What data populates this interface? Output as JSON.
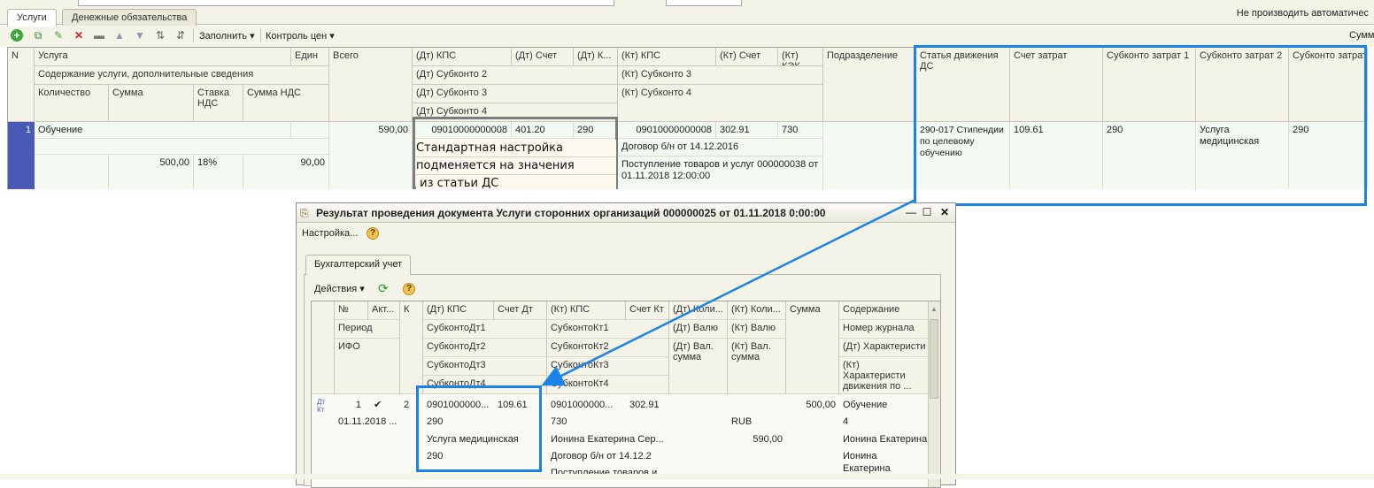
{
  "tabs": [
    "Услуги",
    "Денежные обязательства"
  ],
  "auto_label": "Не производить автоматичес",
  "toolbar": {
    "fill": "Заполнить",
    "price_control": "Контроль цен",
    "sum_label": "Сумм"
  },
  "grid": {
    "headers": {
      "n": "N",
      "service": "Услуга",
      "unit": "Един",
      "content": "Содержание услуги, дополнительные сведения",
      "qty": "Количество",
      "sum": "Сумма",
      "vat_rate": "Ставка НДС",
      "vat_sum": "Сумма НДС",
      "total": "Всего",
      "dt_kps": "(Дт) КПС",
      "dt_account": "(Дт) Счет",
      "dt_k": "(Дт) К...",
      "dt_sub2": "(Дт) Субконто 2",
      "dt_sub3": "(Дт) Субконто 3",
      "dt_sub4": "(Дт) Субконто 4",
      "kt_kps": "(Кт) КПС",
      "kt_account": "(Кт) Счет",
      "kt_kek": "(Кт) КЭК",
      "kt_sub3": "(Кт) Субконто 3",
      "kt_sub4": "(Кт) Субконто 4",
      "division": "Подразделение",
      "cashflow": "Статья движения ДС",
      "cost_account": "Счет затрат",
      "cost_sub1": "Субконто затрат 1",
      "cost_sub2": "Субконто затрат 2",
      "cost_sub3": "Субконто затрат 3"
    },
    "row": {
      "n": "1",
      "service": "Обучение",
      "sum": "500,00",
      "vat_rate": "18%",
      "vat_sum": "90,00",
      "total": "590,00",
      "dt_kps": "09010000000008",
      "dt_account": "401.20",
      "dt_k": "290",
      "kt_kps": "09010000000008",
      "kt_account": "302.91",
      "kt_kek": "730",
      "kt_sub3": "Договор б/н от 14.12.2016",
      "kt_sub4": "Поступление товаров и услуг 000000038 от 01.11.2018 12:00:00",
      "cashflow": "290-017 Стипендии по целевому обучению",
      "cost_account": "109.61",
      "cost_sub1": "290",
      "cost_sub2": "Услуга медицинская",
      "cost_sub3": "290"
    }
  },
  "callout": [
    "Стандартная настройка",
    "подменяется на значения",
    " из статьи ДС"
  ],
  "dialog": {
    "title": "Результат проведения документа Услуги сторонних организаций 000000025 от 01.11.2018 0:00:00",
    "settings": "Настройка...",
    "tab": "Бухгалтерский учет",
    "actions": "Действия",
    "headers": {
      "num": "№",
      "act": "Акт...",
      "k": "К",
      "period": "Период",
      "ifo": "ИФО",
      "dt_kps": "(Дт) КПС",
      "dt_account": "Счет Дт",
      "sub_dt1": "СубконтоДт1",
      "sub_dt2": "СубконтоДт2",
      "sub_dt3": "СубконтоДт3",
      "sub_dt4": "СубконтоДт4",
      "kt_kps": "(Кт) КПС",
      "kt_account": "Счет Кт",
      "sub_kt1": "СубконтоКт1",
      "sub_kt2": "СубконтоКт2",
      "sub_kt3": "СубконтоКт3",
      "sub_kt4": "СубконтоКт4",
      "dt_qty": "(Дт) Коли...",
      "dt_cur": "(Дт) Валю",
      "dt_cur_sum": "(Дт) Вал. сумма",
      "kt_qty": "(Кт) Коли...",
      "kt_cur": "(Кт) Валю",
      "kt_cur_sum": "(Кт) Вал. сумма",
      "sum": "Сумма",
      "content": "Содержание",
      "journal": "Номер журнала",
      "dt_char": "(Дт) Характеристи",
      "kt_char": "(Кт) Характеристи движения по ..."
    },
    "row": {
      "dtkt": "Дт Кт",
      "num": "1",
      "check": "✔",
      "k": "2",
      "period": "01.11.2018 ...",
      "dt_kps": "0901000000...",
      "dt_account": "109.61",
      "sub_dt1": "290",
      "sub_dt2": "Услуга медицинская",
      "sub_dt3": "290",
      "kt_kps": "0901000000...",
      "kt_account": "302.91",
      "sub_kt1": "730",
      "sub_kt2": "Ионина Екатерина Сер...",
      "sub_kt3": "Договор б/н от 14.12.2",
      "sub_kt4": "Поступление товаров и...",
      "kt_cur": "RUB",
      "kt_cur_sum": "590,00",
      "sum": "500,00",
      "content": "Обучение",
      "journal": "4",
      "dt_char": "Ионина Екатерина",
      "kt_char": "Ионина Екатерина Сергеевна"
    }
  },
  "colors": {
    "accent_blue": "#1a82e8",
    "callout_gray": "#7c7c7c",
    "selected_row": "#4a59b5",
    "panel": "#f4f3e8"
  }
}
